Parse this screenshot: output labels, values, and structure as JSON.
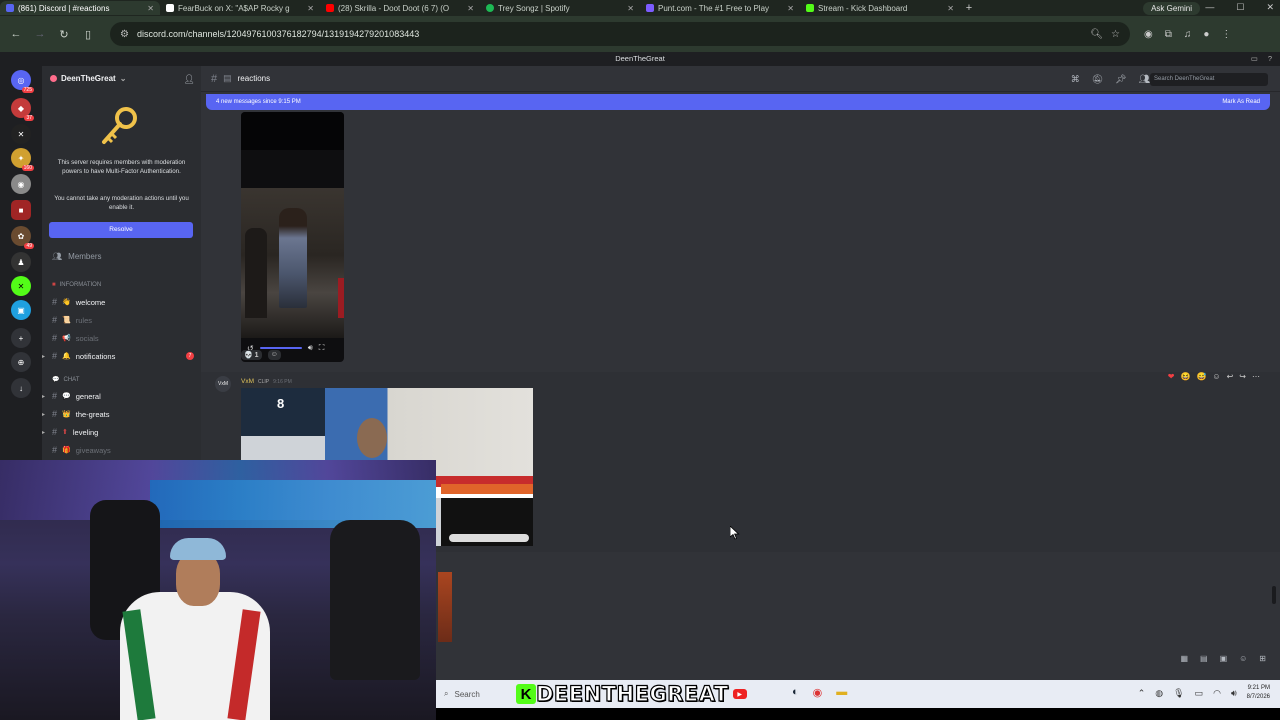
{
  "browser": {
    "tabs": [
      {
        "title": "(861) Discord | #reactions",
        "color": "#5865f2",
        "active": true
      },
      {
        "title": "FearBuck on X: \"A$AP Rocky g",
        "color": "#ffffff",
        "active": false
      },
      {
        "title": "(28) Skrilla - Doot Doot (6 7) (O",
        "color": "#ff0000",
        "active": false
      },
      {
        "title": "Trey Songz | Spotify",
        "color": "#1db954",
        "active": false
      },
      {
        "title": "Punt.com - The #1 Free to Play",
        "color": "#7c5cff",
        "active": false
      },
      {
        "title": "Stream - Kick Dashboard",
        "color": "#53fc18",
        "active": false
      }
    ],
    "gemini_label": "Ask Gemini",
    "url": "discord.com/channels/1204976100376182794/1319194279201083443"
  },
  "discord": {
    "window_title": "DeenTheGreat",
    "server_name": "DeenTheGreat",
    "mfa_notice": "This server requires members with moderation powers to have Multi-Factor Authentication.",
    "mfa_warning": "You cannot take any moderation actions until you enable it.",
    "resolve_label": "Resolve",
    "members_label": "Members",
    "categories": {
      "information": "INFORMATION",
      "chat": "CHAT"
    },
    "channels": {
      "welcome": "welcome",
      "rules": "rules",
      "socials": "socials",
      "notifications": "notifications",
      "notifications_badge": "7",
      "general": "general",
      "the_greats": "the-greats",
      "leveling": "leveling",
      "giveaways": "giveaways"
    },
    "current_channel": "reactions",
    "search_placeholder": "Search DeenTheGreat",
    "new_messages_banner": "4 new messages since 9:15 PM",
    "mark_as_read": "Mark As Read",
    "reaction_count": "1",
    "message": {
      "author": "VxM",
      "tag": "CLIP",
      "time": "9:16 PM",
      "clip_number": "8"
    },
    "server_badges": [
      "725",
      "37",
      "160",
      "49"
    ]
  },
  "taskbar": {
    "search_label": "Search",
    "brand_text": "DEENTHEGREAT",
    "brand_letter": "K",
    "time": "9:21 PM",
    "date": "8/7/2026"
  }
}
